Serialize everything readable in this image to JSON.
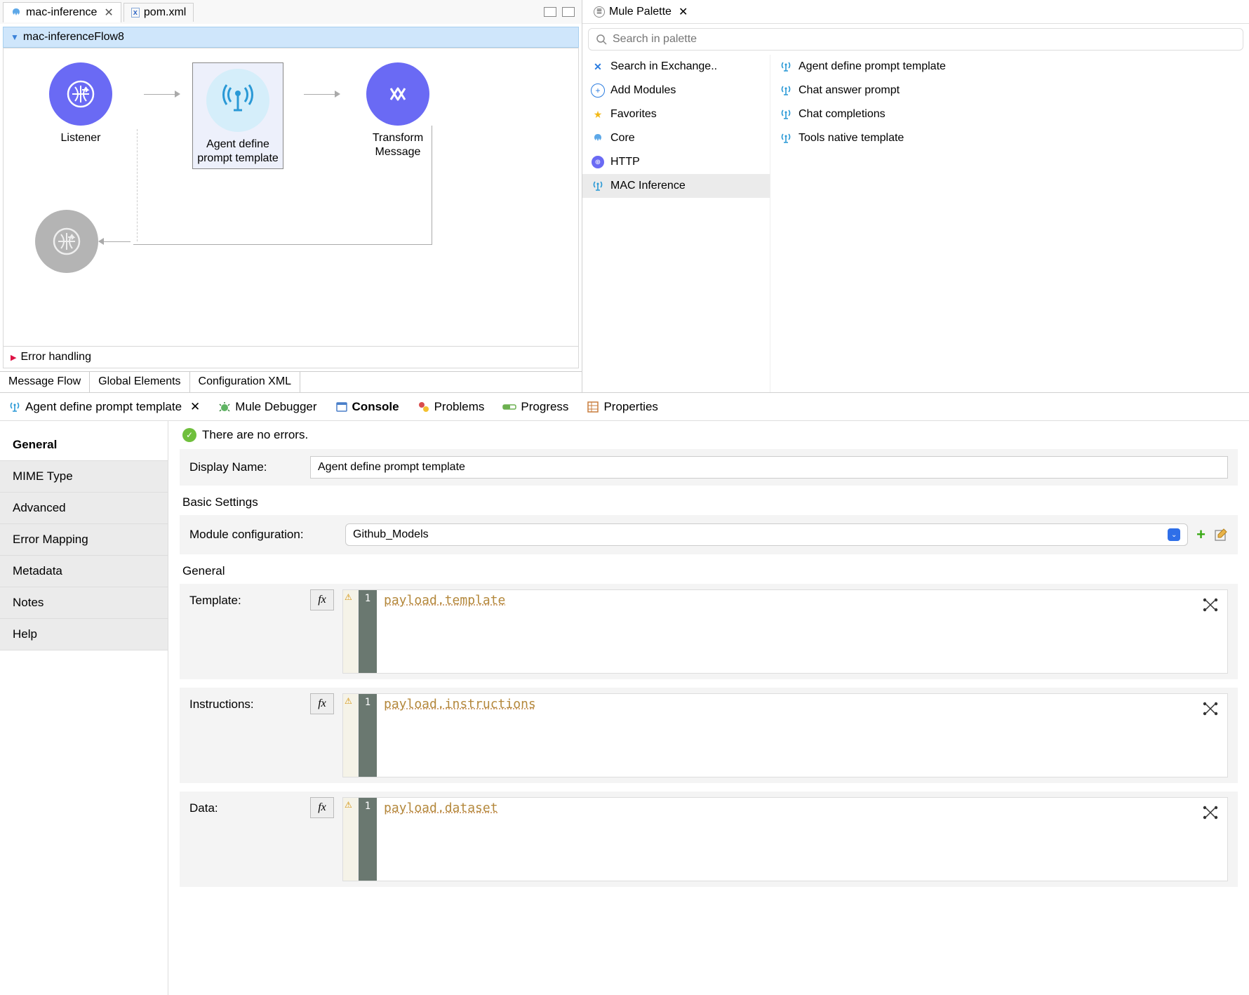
{
  "editor": {
    "tabs": [
      {
        "label": "mac-inference",
        "active": true
      },
      {
        "label": "pom.xml",
        "active": false
      }
    ],
    "flowName": "mac-inferenceFlow8",
    "nodes": {
      "listener": "Listener",
      "agent": "Agent define\nprompt template",
      "transform": "Transform\nMessage"
    },
    "errorHandling": "Error handling",
    "bottomTabs": [
      "Message Flow",
      "Global Elements",
      "Configuration XML"
    ]
  },
  "palette": {
    "title": "Mule Palette",
    "searchPlaceholder": "Search in palette",
    "leftItems": [
      {
        "icon": "exchange",
        "label": "Search in Exchange.."
      },
      {
        "icon": "plus",
        "label": "Add Modules"
      },
      {
        "icon": "star",
        "label": "Favorites"
      },
      {
        "icon": "core",
        "label": "Core"
      },
      {
        "icon": "http",
        "label": "HTTP"
      },
      {
        "icon": "antenna",
        "label": "MAC Inference",
        "selected": true
      }
    ],
    "rightItems": [
      "Agent define prompt template",
      "Chat answer prompt",
      "Chat completions",
      "Tools native template"
    ]
  },
  "bottomTabsRow": {
    "agentTab": "Agent define prompt template",
    "tabs": [
      "Mule Debugger",
      "Console",
      "Problems",
      "Progress",
      "Properties"
    ]
  },
  "properties": {
    "sideItems": [
      "General",
      "MIME Type",
      "Advanced",
      "Error Mapping",
      "Metadata",
      "Notes",
      "Help"
    ],
    "statusMessage": "There are no errors.",
    "displayNameLabel": "Display Name:",
    "displayNameValue": "Agent define prompt template",
    "basicSettingsTitle": "Basic Settings",
    "moduleConfigLabel": "Module configuration:",
    "moduleConfigValue": "Github_Models",
    "generalTitle": "General",
    "fields": [
      {
        "label": "Template:",
        "code": "payload.template"
      },
      {
        "label": "Instructions:",
        "code": "payload.instructions"
      },
      {
        "label": "Data:",
        "code": "payload.dataset"
      }
    ]
  }
}
